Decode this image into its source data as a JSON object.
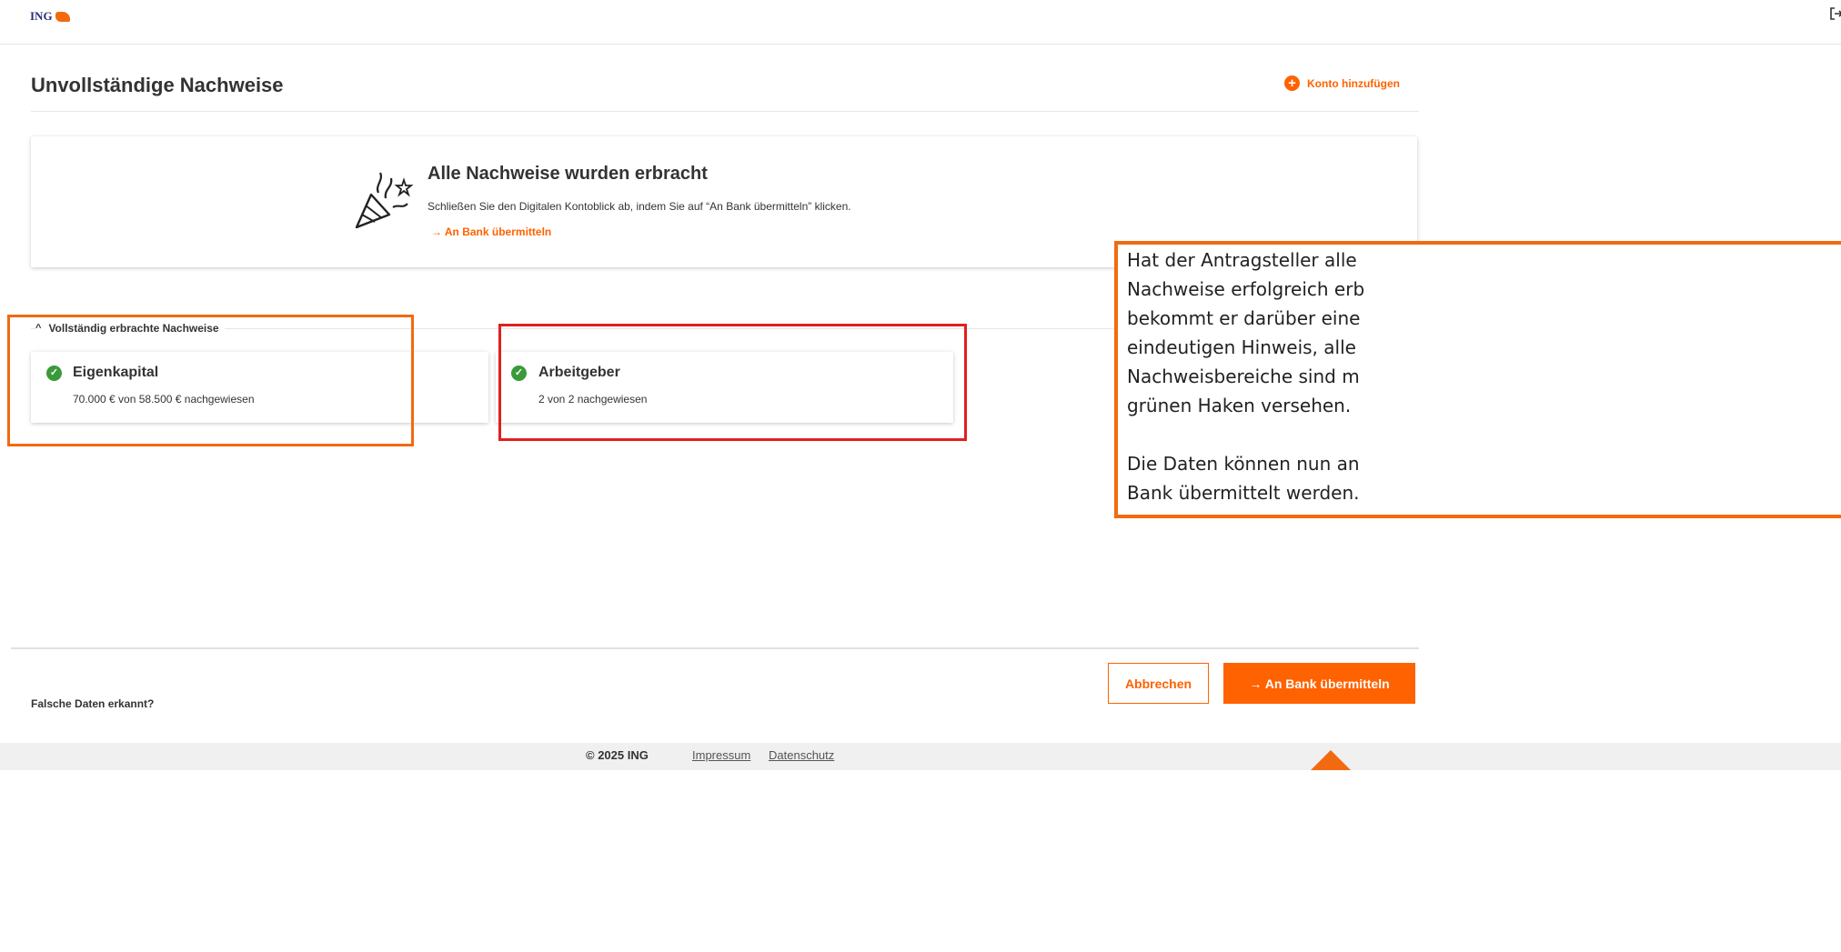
{
  "header": {
    "logo_text": "ING",
    "logout_icon": "logout-icon"
  },
  "page": {
    "title": "Unvollständige Nachweise",
    "add_account_label": "Konto hinzufügen"
  },
  "success": {
    "title": "Alle Nachweise wurden erbracht",
    "text": "Schließen Sie den Digitalen Kontoblick ab, indem Sie auf “An Bank übermitteln” klicken.",
    "link_label": "→ An Bank übermitteln"
  },
  "section": {
    "toggle_label": "Vollständig erbrachte Nachweise",
    "cards": [
      {
        "title": "Eigenkapital",
        "subtitle": "70.000 € von 58.500 € nachgewiesen"
      },
      {
        "title": "Arbeitgeber",
        "subtitle": "2 von 2 nachgewiesen"
      }
    ]
  },
  "annotation": {
    "text": "Hat der Antragsteller alle\nNachweise erfolgreich erb\nbekommt er darüber eine\neindeutigen Hinweis, alle\nNachweisbereiche sind m\ngrünen Haken versehen.\n\nDie Daten können nun an\nBank übermittelt werden."
  },
  "footer": {
    "wrong_data": "Falsche Daten erkannt?",
    "cancel_label": "Abbrechen",
    "submit_label": "→  An Bank übermitteln",
    "copyright": "© 2025 ING",
    "links": [
      "Impressum",
      "Datenschutz"
    ]
  },
  "colors": {
    "brand_orange": "#ff6200",
    "success_green": "#3a9a3a",
    "annotation_orange": "#f26a10",
    "annotation_red": "#e02020"
  }
}
